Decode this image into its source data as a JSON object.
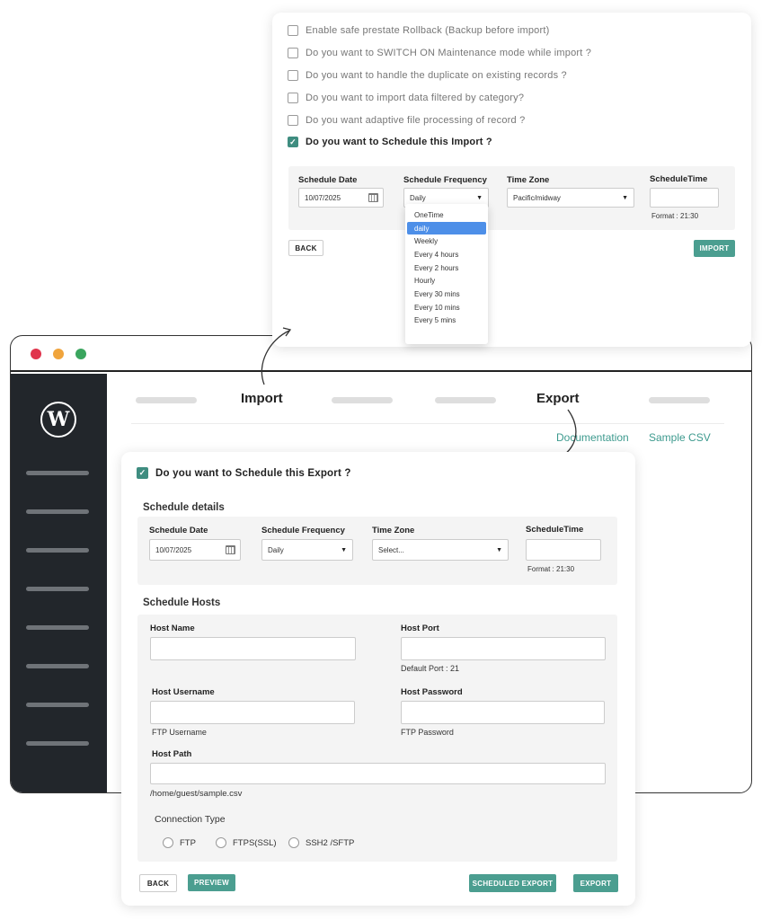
{
  "import_card": {
    "options": [
      {
        "label": "Enable safe prestate Rollback (Backup before import)",
        "checked": false
      },
      {
        "label": "Do you want to SWITCH ON Maintenance mode while import ?",
        "checked": false
      },
      {
        "label": "Do you want to handle the duplicate on existing records ?",
        "checked": false
      },
      {
        "label": "Do you want to import data filtered by category?",
        "checked": false
      },
      {
        "label": "Do you want adaptive file processing of record ?",
        "checked": false
      },
      {
        "label": "Do you want to Schedule this Import ?",
        "checked": true
      }
    ],
    "schedule": {
      "date_label": "Schedule Date",
      "date_value": "10/07/2025",
      "frequency_label": "Schedule Frequency",
      "frequency_value": "Daily",
      "timezone_label": "Time Zone",
      "timezone_value": "Pacific/midway",
      "time_label": "ScheduleTime",
      "time_hint": "Format : 21:30"
    },
    "frequency_options": [
      "OneTime",
      "daily",
      "Weekly",
      "Every 4 hours",
      "Every 2 hours",
      "Hourly",
      "Every 30 mins",
      "Every 10 mins",
      "Every 5 mins"
    ],
    "frequency_selected": "daily",
    "back_label": "BACK",
    "import_label": "IMPORT"
  },
  "browser": {
    "nav": {
      "import": "Import",
      "export": "Export"
    },
    "links": {
      "documentation": "Documentation",
      "sample_csv": "Sample CSV"
    }
  },
  "export_card": {
    "schedule_checkbox": "Do you want to Schedule this Export ?",
    "schedule_details_title": "Schedule details",
    "schedule": {
      "date_label": "Schedule Date",
      "date_value": "10/07/2025",
      "frequency_label": "Schedule Frequency",
      "frequency_value": "Daily",
      "timezone_label": "Time Zone",
      "timezone_value": "Select...",
      "time_label": "ScheduleTime",
      "time_hint": "Format : 21:30"
    },
    "hosts_title": "Schedule Hosts",
    "hosts": {
      "host_name_label": "Host Name",
      "host_port_label": "Host Port",
      "host_port_hint": "Default Port : 21",
      "username_label": "Host Username",
      "username_hint": "FTP Username",
      "password_label": "Host Password",
      "password_hint": "FTP Password",
      "path_label": "Host Path",
      "path_hint": "/home/guest/sample.csv",
      "connection_label": "Connection Type",
      "connection_options": [
        "FTP",
        "FTPS(SSL)",
        "SSH2 /SFTP"
      ]
    },
    "buttons": {
      "back": "BACK",
      "preview": "PREVIEW",
      "scheduled_export": "SCHEDULED EXPORT",
      "export": "EXPORT"
    }
  },
  "colors": {
    "accent": "#4b9e90",
    "sidebar": "#22262b",
    "dropdown_selected": "#4d8fe8"
  }
}
